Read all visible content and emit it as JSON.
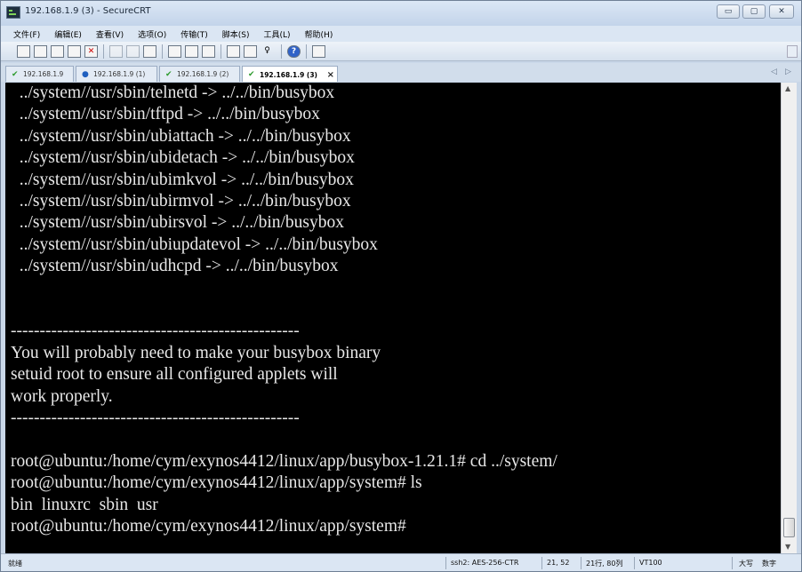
{
  "window": {
    "title": "192.168.1.9 (3) - SecureCRT",
    "controls": {
      "minimize": "▭",
      "maximize": "▢",
      "close": "✕"
    }
  },
  "menu": [
    "文件(F)",
    "编辑(E)",
    "查看(V)",
    "选项(O)",
    "传输(T)",
    "脚本(S)",
    "工具(L)",
    "帮助(H)"
  ],
  "toolbar": {
    "icons": [
      "connect-icon",
      "quick-connect-icon",
      "connect-tab-icon",
      "reconnect-icon",
      "disconnect-icon",
      "copy-icon",
      "paste-icon",
      "find-icon",
      "print-icon",
      "print-setup-icon",
      "print-screen-icon",
      "session-options-icon",
      "global-options-icon",
      "key-icon",
      "help-icon",
      "sftp-icon"
    ]
  },
  "tabs": [
    {
      "label": "192.168.1.9",
      "icon": "check-icon",
      "active": false
    },
    {
      "label": "192.168.1.9 (1)",
      "icon": "info-icon",
      "active": false
    },
    {
      "label": "192.168.1.9 (2)",
      "icon": "check-icon",
      "active": false
    },
    {
      "label": "192.168.1.9 (3)",
      "icon": "check-icon",
      "active": true
    }
  ],
  "tab_close": "×",
  "tab_scroll": {
    "left": "◁",
    "right": "▷"
  },
  "terminal": {
    "lines": [
      "  ../system//usr/sbin/telnetd -> ../../bin/busybox",
      "  ../system//usr/sbin/tftpd -> ../../bin/busybox",
      "  ../system//usr/sbin/ubiattach -> ../../bin/busybox",
      "  ../system//usr/sbin/ubidetach -> ../../bin/busybox",
      "  ../system//usr/sbin/ubimkvol -> ../../bin/busybox",
      "  ../system//usr/sbin/ubirmvol -> ../../bin/busybox",
      "  ../system//usr/sbin/ubirsvol -> ../../bin/busybox",
      "  ../system//usr/sbin/ubiupdatevol -> ../../bin/busybox",
      "  ../system//usr/sbin/udhcpd -> ../../bin/busybox",
      "",
      "",
      "--------------------------------------------------",
      "You will probably need to make your busybox binary",
      "setuid root to ensure all configured applets will",
      "work properly.",
      "--------------------------------------------------",
      "",
      "root@ubuntu:/home/cym/exynos4412/linux/app/busybox-1.21.1# cd ../system/",
      "root@ubuntu:/home/cym/exynos4412/linux/app/system# ls",
      "bin  linuxrc  sbin  usr",
      "root@ubuntu:/home/cym/exynos4412/linux/app/system# "
    ]
  },
  "statusbar": {
    "ready": "就绪",
    "encryption": "ssh2: AES-256-CTR",
    "cursor": "21,  52",
    "size": "21行, 80列",
    "emulation": "VT100",
    "caps": "大写",
    "num": "数字"
  }
}
